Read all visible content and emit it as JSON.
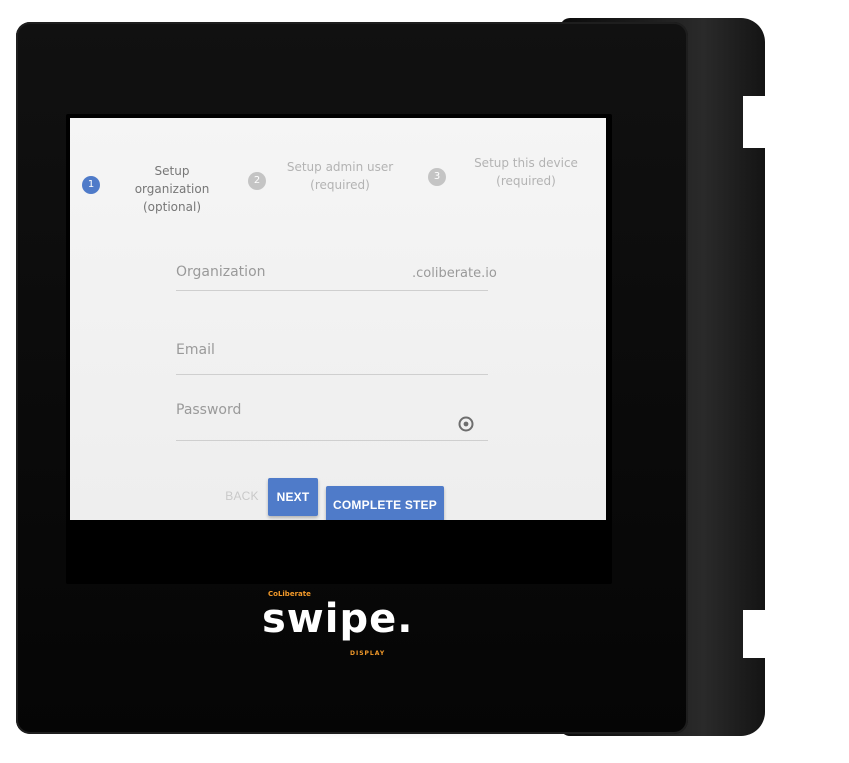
{
  "stepper": {
    "steps": [
      {
        "number": "1",
        "title": "Setup organization",
        "subtitle": "(optional)",
        "active": true
      },
      {
        "number": "2",
        "title": "Setup admin user",
        "subtitle": "(required)",
        "active": false
      },
      {
        "number": "3",
        "title": "Setup this device",
        "subtitle": "(required)",
        "active": false
      }
    ]
  },
  "form": {
    "organization": {
      "placeholder": "Organization",
      "suffix": ".coliberate.io"
    },
    "email": {
      "placeholder": "Email"
    },
    "password": {
      "placeholder": "Password"
    }
  },
  "actions": {
    "back_label": "BACK",
    "next_label": "NEXT",
    "complete_label": "COMPLETE STEP"
  },
  "brand": {
    "top": "CoLiberate",
    "word": "swipe.",
    "bottom": "DISPLAY"
  },
  "colors": {
    "accent": "#4f7bc9",
    "step_inactive": "#c4c4c4",
    "logo_orange": "#f39a2a",
    "bezel": "#0a0a0a"
  },
  "icons": {
    "password_toggle": "eye-icon"
  }
}
